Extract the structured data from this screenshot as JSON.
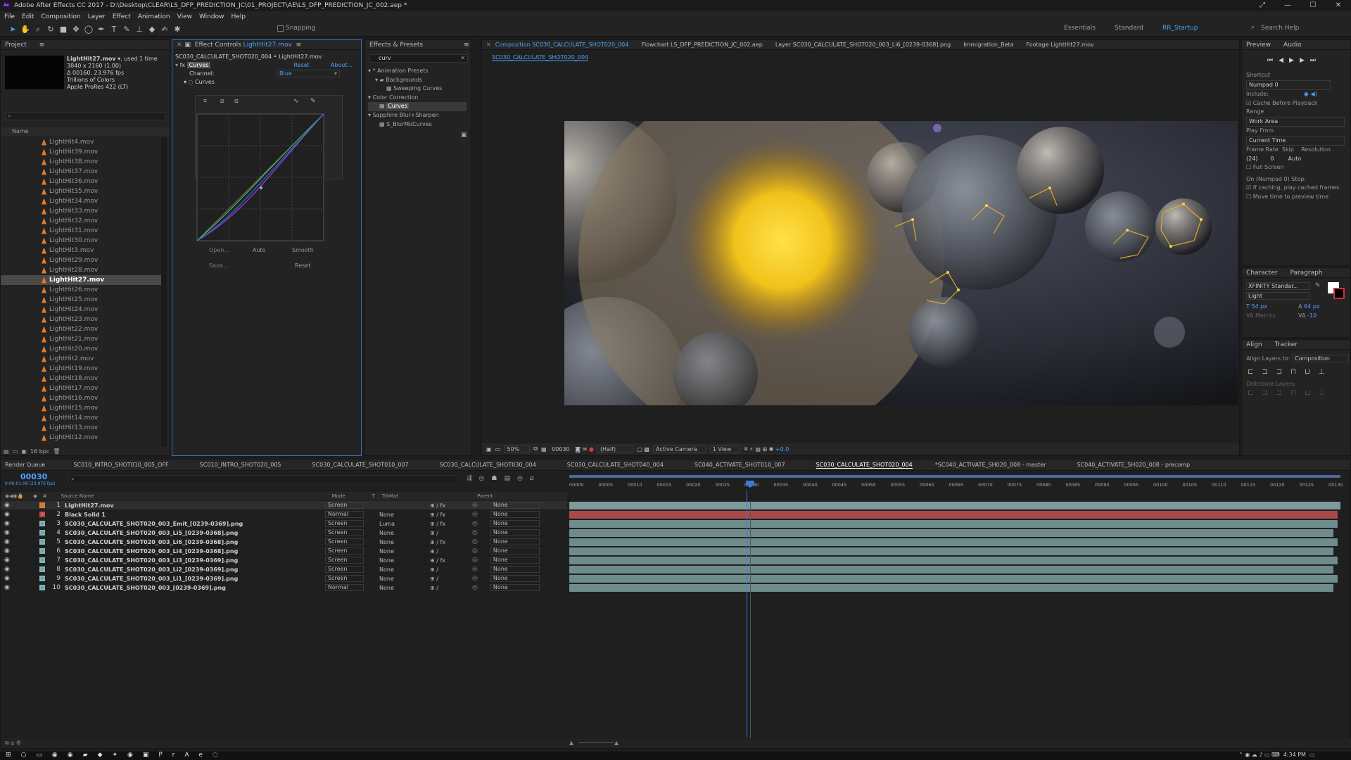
{
  "window": {
    "title": "Adobe After Effects CC 2017 - D:\\Desktop\\CLEAR\\LS_DFP_PREDICTION_JC\\01_PROJECT\\AE\\LS_DFP_PREDICTION_JC_002.aep *"
  },
  "menu": [
    "File",
    "Edit",
    "Composition",
    "Layer",
    "Effect",
    "Animation",
    "View",
    "Window",
    "Help"
  ],
  "toolbar": {
    "snapping": "Snapping",
    "workspaces": [
      "Essentials",
      "Standard",
      "RR_Startup"
    ],
    "search_placeholder": "Search Help"
  },
  "project": {
    "title": "Project",
    "selected_file": "LightHit27.mov",
    "used": ", used 1 time",
    "info": [
      "3840 x 2160 (1.00)",
      "Δ 00160, 23.976 fps",
      "Trillions of Colors",
      "Apple ProRes 422 (LT)"
    ],
    "column": "Name",
    "files": [
      "LightHit4.mov",
      "LightHit39.mov",
      "LightHit38.mov",
      "LightHit37.mov",
      "LightHit36.mov",
      "LightHit35.mov",
      "LightHit34.mov",
      "LightHit33.mov",
      "LightHit32.mov",
      "LightHit31.mov",
      "LightHit30.mov",
      "LightHit3.mov",
      "LightHit29.mov",
      "LightHit28.mov",
      "LightHit27.mov",
      "LightHit26.mov",
      "LightHit25.mov",
      "LightHit24.mov",
      "LightHit23.mov",
      "LightHit22.mov",
      "LightHit21.mov",
      "LightHit20.mov",
      "LightHit2.mov",
      "LightHit19.mov",
      "LightHit18.mov",
      "LightHit17.mov",
      "LightHit16.mov",
      "LightHit15.mov",
      "LightHit14.mov",
      "LightHit13.mov",
      "LightHit12.mov"
    ],
    "bpc": "16 bpc"
  },
  "effect_controls": {
    "tab": "Effect Controls",
    "layer": "LightHit27.mov",
    "path": "SC030_CALCULATE_SHOT020_004 • LightHit27.mov",
    "effect": "Curves",
    "reset": "Reset",
    "about": "About...",
    "channel_label": "Channel:",
    "channel_value": "Blue",
    "prop": "Curves",
    "buttons": [
      "Open...",
      "Auto",
      "Smooth",
      "Save...",
      "Reset"
    ]
  },
  "effects_presets": {
    "title": "Effects & Presets",
    "search": "curv",
    "tree": [
      "* Animation Presets",
      "Backgrounds",
      "Sweeping Curves",
      "Color Correction",
      "Curves",
      "Sapphire Blur+Sharpen",
      "S_BlurMoCurves"
    ]
  },
  "viewer": {
    "tabs": [
      "Composition SC030_CALCULATE_SHOT020_004",
      "Flowchart LS_DFP_PREDICTION_JC_002.aep",
      "Layer SC030_CALCULATE_SHOT020_003_Li6_[0239-0368].png",
      "Immigration_Beta",
      "Footage LightHit27.mov"
    ],
    "crumb": "SC030_CALCULATE_SHOT020_004",
    "zoom": "50%",
    "timecode": "00030",
    "resolution": "(Half)",
    "camera": "Active Camera",
    "views": "1 View",
    "exposure": "+0.0"
  },
  "preview": {
    "tabs": [
      "Preview",
      "Audio"
    ],
    "shortcut_label": "Shortcut",
    "shortcut": "Numpad 0",
    "include": "Include:",
    "cache": "Cache Before Playback",
    "range_label": "Range",
    "range": "Work Area",
    "play_from_label": "Play From",
    "play_from": "Current Time",
    "frame_rate": "Frame Rate",
    "skip": "Skip",
    "resolution": "Resolution",
    "fr_val": "(24)",
    "skip_val": "0",
    "res_val": "Auto",
    "full_screen": "Full Screen",
    "stop_label": "On (Numpad 0) Stop:",
    "cached": "If caching, play cached frames",
    "move_time": "Move time to preview time"
  },
  "character": {
    "tabs": [
      "Character",
      "Paragraph"
    ],
    "font": "XFINITY Standar...",
    "style": "Light",
    "size": "54 px",
    "leading": "64 px",
    "tracking": "Metrics",
    "baseline": "-10"
  },
  "align": {
    "tabs": [
      "Align",
      "Tracker"
    ],
    "align_to_label": "Align Layers to:",
    "align_to": "Composition",
    "distribute": "Distribute Layers:"
  },
  "timeline": {
    "render_queue": "Render Queue",
    "tabs": [
      "SC010_INTRO_SHOT010_005_OFF",
      "SC010_INTRO_SHOT020_005",
      "SC030_CALCULATE_SHOT010_007",
      "SC030_CALCULATE_SHOT030_004",
      "SC030_CALCULATE_SHOT040_004",
      "SC040_ACTIVATE_SHOT010_007",
      "SC030_CALCULATE_SHOT020_004",
      "*SC040_ACTIVATE_SH020_008 - master",
      "SC040_ACTIVATE_SH020_008 - precomp"
    ],
    "timecode": "00030",
    "sub_tc": "0:00:01:06 (23.976 fps)",
    "cols": [
      "#",
      "Source Name",
      "Mode",
      "T",
      "TrkMat",
      "Parent"
    ],
    "ruler": [
      "00000",
      "00005",
      "00010",
      "00015",
      "00020",
      "00025",
      "00030",
      "00035",
      "00040",
      "00045",
      "00050",
      "00055",
      "00060",
      "00065",
      "00070",
      "00075",
      "00080",
      "00085",
      "00090",
      "00095",
      "00100",
      "00105",
      "00110",
      "00115",
      "00120",
      "00125",
      "00130"
    ],
    "layers": [
      {
        "n": "1",
        "name": "LightHit27.mov",
        "mode": "Screen",
        "trk": "",
        "fx": "fx",
        "parent": "None",
        "color": "#e07b2a"
      },
      {
        "n": "2",
        "name": "Black Solid 1",
        "mode": "Normal",
        "trk": "None",
        "fx": "fx",
        "parent": "None",
        "color": "#d04040"
      },
      {
        "n": "3",
        "name": "SC030_CALCULATE_SHOT020_003_Emit_[0239-0369].png",
        "mode": "Screen",
        "trk": "Luma",
        "fx": "fx",
        "parent": "None",
        "color": "#7ab8b8"
      },
      {
        "n": "4",
        "name": "SC030_CALCULATE_SHOT020_003_Li5_[0239-0368].png",
        "mode": "Screen",
        "trk": "None",
        "fx": "",
        "parent": "None",
        "color": "#7ab8b8"
      },
      {
        "n": "5",
        "name": "SC030_CALCULATE_SHOT020_003_Li6_[0239-0368].png",
        "mode": "Screen",
        "trk": "None",
        "fx": "fx",
        "parent": "None",
        "color": "#7ab8b8"
      },
      {
        "n": "6",
        "name": "SC030_CALCULATE_SHOT020_003_Li4_[0239-0368].png",
        "mode": "Screen",
        "trk": "None",
        "fx": "",
        "parent": "None",
        "color": "#7ab8b8"
      },
      {
        "n": "7",
        "name": "SC030_CALCULATE_SHOT020_003_Li3_[0239-0369].png",
        "mode": "Screen",
        "trk": "None",
        "fx": "fx",
        "parent": "None",
        "color": "#7ab8b8"
      },
      {
        "n": "8",
        "name": "SC030_CALCULATE_SHOT020_003_Li2_[0239-0369].png",
        "mode": "Screen",
        "trk": "None",
        "fx": "",
        "parent": "None",
        "color": "#7ab8b8"
      },
      {
        "n": "9",
        "name": "SC030_CALCULATE_SHOT020_003_Li1_[0239-0369].png",
        "mode": "Screen",
        "trk": "None",
        "fx": "",
        "parent": "None",
        "color": "#7ab8b8"
      },
      {
        "n": "10",
        "name": "SC030_CALCULATE_SHOT020_003_[0239-0369].png",
        "mode": "Normal",
        "trk": "None",
        "fx": "",
        "parent": "None",
        "color": "#7ab8b8"
      }
    ]
  },
  "taskbar": {
    "time": "4:34 PM"
  }
}
